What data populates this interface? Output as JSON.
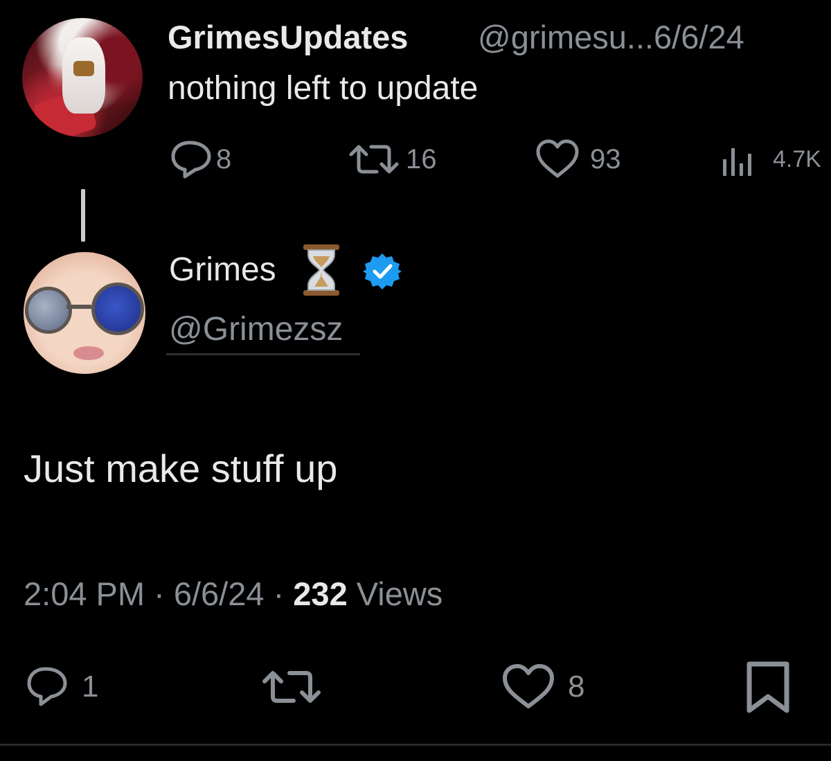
{
  "parent_tweet": {
    "display_name": "GrimesUpdates",
    "handle_and_date": "@grimesu...6/6/24",
    "text": "nothing left to update",
    "actions": {
      "replies": "8",
      "reposts": "16",
      "likes": "93",
      "views": "4.7K"
    }
  },
  "main_tweet": {
    "display_name": "Grimes",
    "handle": "@Grimezsz",
    "text": "Just make stuff up",
    "meta": {
      "time": "2:04 PM",
      "separator": " · ",
      "date": "6/6/24",
      "views_count": "232",
      "views_label": " Views"
    },
    "actions": {
      "replies": "1",
      "likes": "8"
    }
  },
  "colors": {
    "background": "#000000",
    "primary_text": "#e7e9ea",
    "secondary_text": "#8b9096",
    "verified_blue": "#1d9bf0"
  },
  "icons": [
    "reply-icon",
    "repost-icon",
    "like-icon",
    "views-icon",
    "hourglass-icon",
    "verified-icon",
    "bookmark-icon"
  ]
}
